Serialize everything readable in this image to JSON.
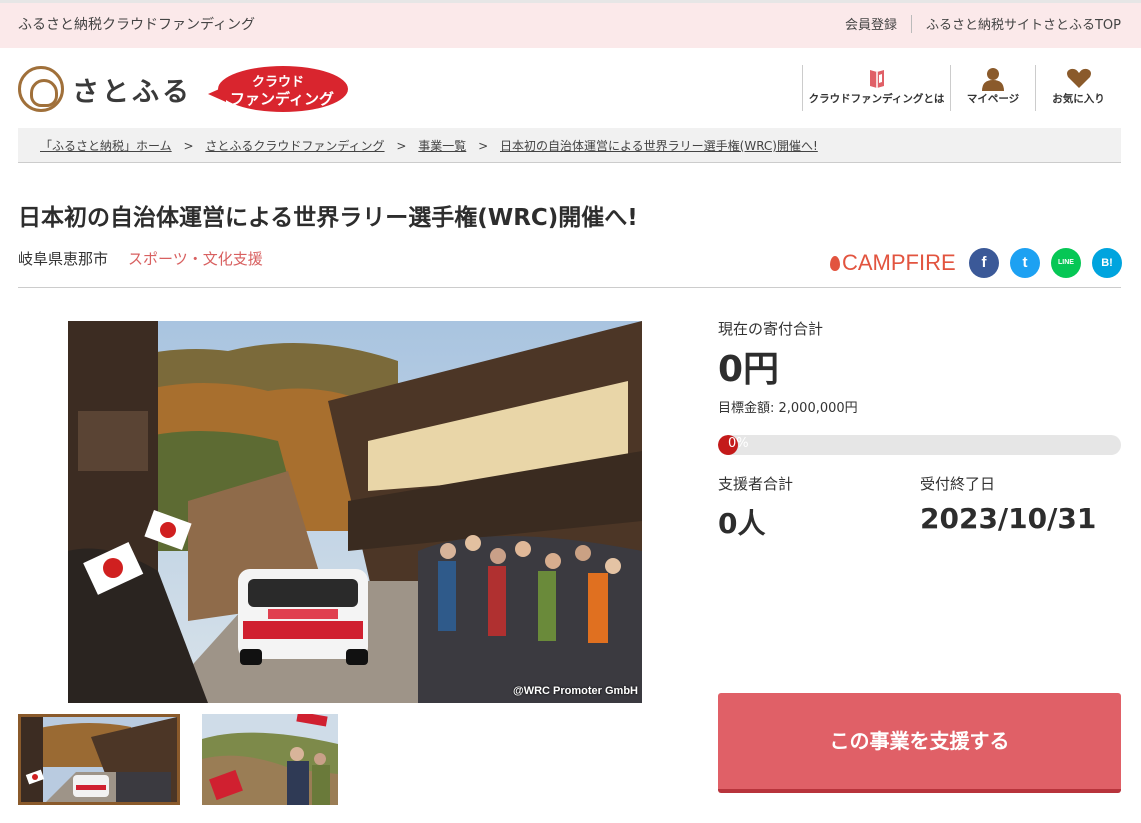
{
  "topbar": {
    "site_name": "ふるさと納税クラウドファンディング",
    "register": "会員登録",
    "top_link": "ふるさと納税サイトさとふるTOP"
  },
  "header": {
    "logo_text": "さとふる",
    "badge_line1": "クラウド",
    "badge_line2": "ファンディング",
    "nav": [
      {
        "label": "クラウドファンディングとは",
        "icon": "book-icon"
      },
      {
        "label": "マイページ",
        "icon": "person-icon"
      },
      {
        "label": "お気に入り",
        "icon": "heart-icon"
      }
    ]
  },
  "breadcrumb": [
    "「ふるさと納税」ホーム",
    "さとふるクラウドファンディング",
    "事業一覧",
    "日本初の自治体運営による世界ラリー選手権(WRC)開催へ!"
  ],
  "breadcrumb_sep": ">",
  "project": {
    "title": "日本初の自治体運営による世界ラリー選手権(WRC)開催へ!",
    "city": "岐阜県恵那市",
    "category": "スポーツ・文化支援",
    "partner": "CAMPFIRE",
    "image_credit": "@WRC Promoter GmbH"
  },
  "share": {
    "facebook": "f",
    "twitter": "t",
    "line": "LINE",
    "hatena": "B!"
  },
  "stats": {
    "total_label": "現在の寄付合計",
    "total_value": "0円",
    "goal_text": "目標金額: 2,000,000円",
    "progress_percent": 0,
    "progress_text": "0%",
    "supporters_label": "支援者合計",
    "supporters_value": "0人",
    "deadline_label": "受付終了日",
    "deadline_value": "2023/10/31"
  },
  "cta": {
    "support_label": "この事業を支援する"
  },
  "colors": {
    "accent": "#e06067",
    "brand_brown": "#8a5a2b",
    "progress_fill": "#c41a1a",
    "topbar_bg": "#fbe9ea"
  }
}
